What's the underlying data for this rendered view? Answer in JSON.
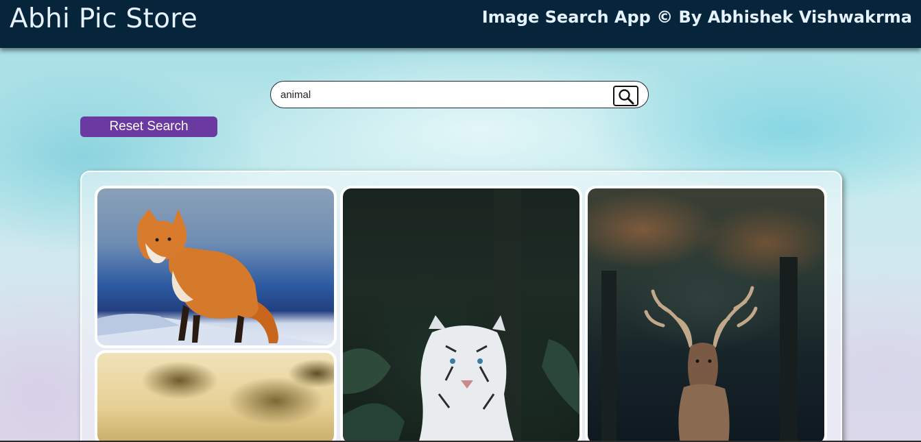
{
  "header": {
    "brand": "Abhi Pic Store",
    "tagline": "Image Search App © By Abhishek Vishwakrma"
  },
  "search": {
    "value": "animal",
    "button_icon": "search-icon"
  },
  "reset": {
    "label": "Reset Search"
  },
  "gallery": {
    "images": [
      {
        "subject": "red fox",
        "icon": "fox-photo"
      },
      {
        "subject": "white tiger",
        "icon": "tiger-photo"
      },
      {
        "subject": "stag deer",
        "icon": "deer-photo"
      },
      {
        "subject": "blurred foliage",
        "icon": "foliage-photo"
      }
    ]
  },
  "colors": {
    "header_bg": "#06253a",
    "header_text": "#e6f3ff",
    "reset_button": "#6b3aa0",
    "card_border": "#ffffff"
  }
}
